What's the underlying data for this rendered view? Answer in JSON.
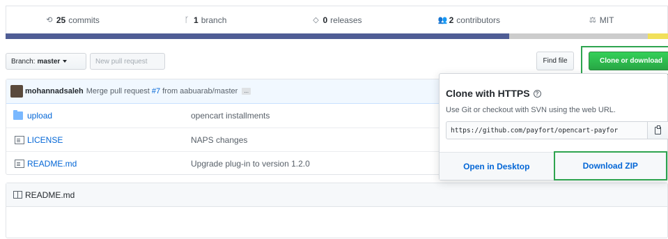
{
  "summary": {
    "commits": {
      "num": "25",
      "label": "commits"
    },
    "branches": {
      "num": "1",
      "label": "branch"
    },
    "releases": {
      "num": "0",
      "label": "releases"
    },
    "contributors": {
      "num": "2",
      "label": "contributors"
    },
    "license": {
      "label": "MIT"
    }
  },
  "languages": [
    {
      "color": "#4F5D95",
      "share": 0.76
    },
    {
      "color": "#cccccc",
      "share": 0.21
    },
    {
      "color": "#f1e05a",
      "share": 0.03
    }
  ],
  "toolbar": {
    "branch_prefix": "Branch:",
    "branch_name": "master",
    "new_pr_label": "New pull request",
    "find_file_label": "Find file",
    "clone_label": "Clone or download"
  },
  "commit": {
    "author": "mohannadsaleh",
    "message_prefix": "Merge pull request",
    "pr_number": "#7",
    "message_suffix": "from aabuarab/master",
    "ellipsis": "..."
  },
  "files": [
    {
      "type": "folder",
      "name": "upload",
      "message": "opencart installments"
    },
    {
      "type": "file",
      "name": "LICENSE",
      "message": "NAPS changes"
    },
    {
      "type": "file",
      "name": "README.md",
      "message": "Upgrade plug-in to version 1.2.0"
    }
  ],
  "readme": {
    "title": "README.md"
  },
  "clone_dropdown": {
    "title": "Clone with HTTPS",
    "description": "Use Git or checkout with SVN using the web URL.",
    "url": "https://github.com/payfort/opencart-payfor",
    "open_desktop_label": "Open in Desktop",
    "download_zip_label": "Download ZIP"
  },
  "colors": {
    "accent_green": "#2ea44f",
    "link_blue": "#0366d6"
  }
}
